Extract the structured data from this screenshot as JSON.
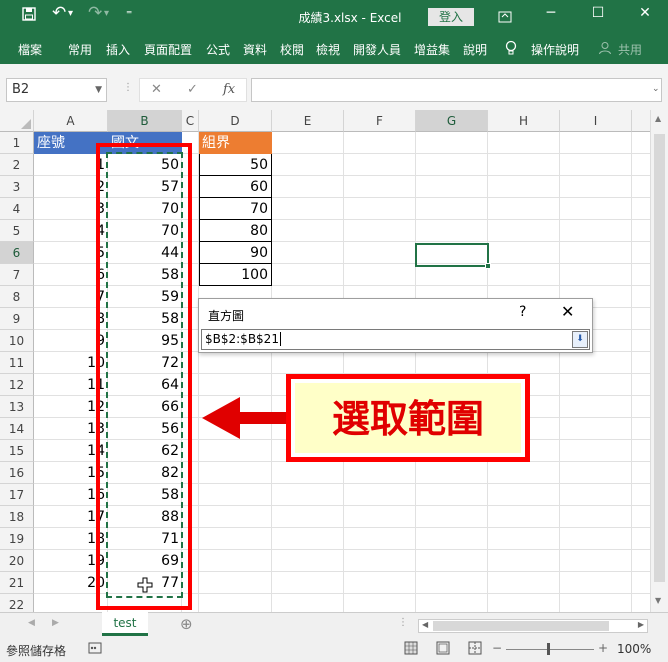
{
  "window": {
    "title": "成績3.xlsx  -  Excel",
    "login": "登入",
    "minimize": "─",
    "restore": "☐",
    "close": "✕"
  },
  "qat": {
    "save": "💾",
    "undo": "↶",
    "redo": "↷",
    "customize": "⌄"
  },
  "ribbon": {
    "tabs": [
      "檔案",
      "常用",
      "插入",
      "頁面配置",
      "公式",
      "資料",
      "校閱",
      "檢視",
      "開發人員",
      "增益集",
      "說明"
    ],
    "tell_me_icon": "lightbulb-icon",
    "tell_me": "操作說明",
    "share_icon": "person-icon",
    "share": "共用"
  },
  "formula_bar": {
    "name_box": "B2",
    "cancel": "✕",
    "enter": "✓",
    "fx": "fx",
    "formula": ""
  },
  "columns": [
    "A",
    "B",
    "C",
    "D",
    "E",
    "F",
    "G",
    "H",
    "I"
  ],
  "rows": [
    "1",
    "2",
    "3",
    "4",
    "5",
    "6",
    "7",
    "8",
    "9",
    "10",
    "11",
    "12",
    "13",
    "14",
    "15",
    "16",
    "17",
    "18",
    "19",
    "20",
    "21",
    "22"
  ],
  "headers": {
    "A1": "座號",
    "B1": "國文",
    "D1": "組界"
  },
  "seat_numbers": [
    "1",
    "2",
    "3",
    "4",
    "5",
    "6",
    "7",
    "8",
    "9",
    "10",
    "11",
    "12",
    "13",
    "14",
    "15",
    "16",
    "17",
    "18",
    "19",
    "20"
  ],
  "chinese_scores": [
    "50",
    "57",
    "70",
    "70",
    "44",
    "58",
    "59",
    "58",
    "95",
    "72",
    "64",
    "66",
    "56",
    "62",
    "82",
    "58",
    "88",
    "71",
    "69",
    "77"
  ],
  "bins": [
    "50",
    "60",
    "70",
    "80",
    "90",
    "100"
  ],
  "dialog": {
    "title": "直方圖",
    "help": "?",
    "close": "✕",
    "range": "$B$2:$B$21"
  },
  "callout": {
    "text": "選取範圍",
    "border_color": "#ff0000",
    "fill_color": "#ffffc8"
  },
  "sheets": {
    "active": "test",
    "add": "⊕"
  },
  "status": {
    "text": "參照儲存格",
    "zoom": "100%",
    "zoom_minus": "−",
    "zoom_plus": "+"
  },
  "colors": {
    "excel_green": "#217346",
    "header_blue": "#4472c4",
    "header_orange": "#ed7d31"
  }
}
